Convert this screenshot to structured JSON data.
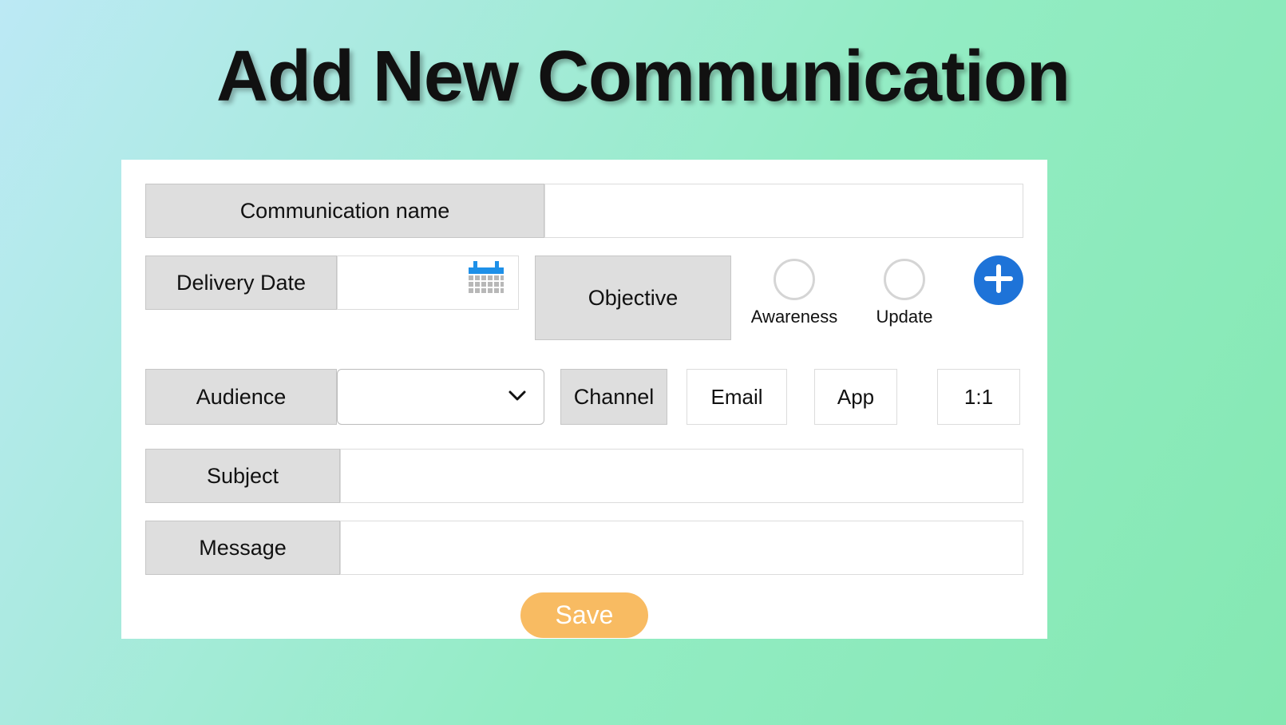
{
  "title": "Add New Communication",
  "labels": {
    "commName": "Communication name",
    "deliveryDate": "Delivery Date",
    "objective": "Objective",
    "audience": "Audience",
    "channel": "Channel",
    "subject": "Subject",
    "message": "Message"
  },
  "objectiveOptions": [
    "Awareness",
    "Update"
  ],
  "channelOptions": [
    "Email",
    "App",
    "1:1"
  ],
  "saveLabel": "Save"
}
